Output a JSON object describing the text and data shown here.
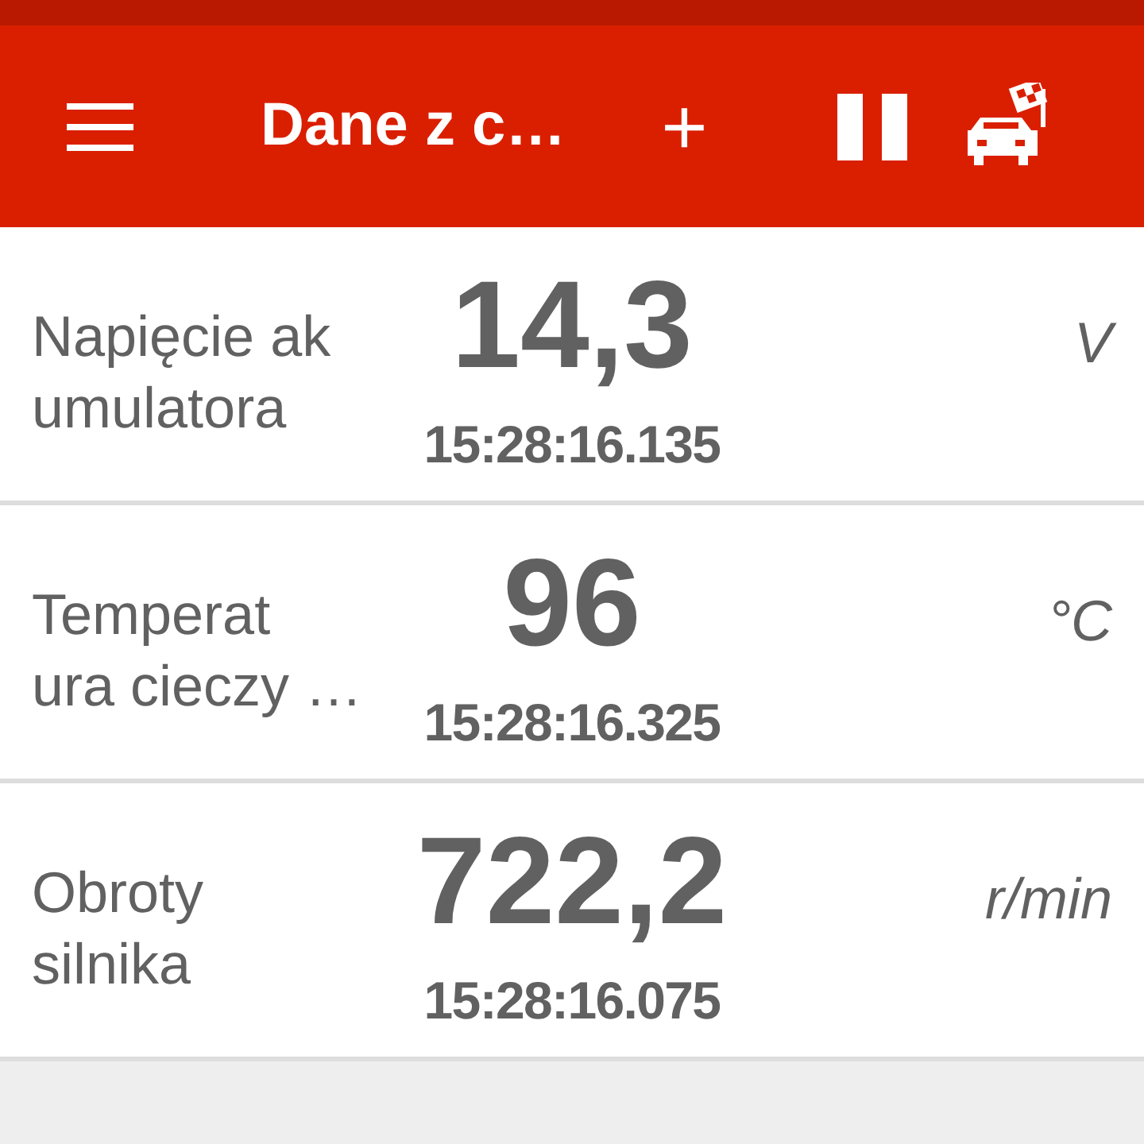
{
  "toolbar": {
    "title": "Dane z c…",
    "add": "+"
  },
  "rows": [
    {
      "label_lines": [
        "Napięcie ak",
        "umulatora"
      ],
      "value": "14,3",
      "time": "15:28:16.135",
      "unit": "V"
    },
    {
      "label_lines": [
        "Temperat",
        "ura cieczy …"
      ],
      "value": "96",
      "time": "15:28:16.325",
      "unit": "°C"
    },
    {
      "label_lines": [
        "Obroty",
        "silnika"
      ],
      "value": "722,2",
      "time": "15:28:16.075",
      "unit": "r/min"
    }
  ]
}
